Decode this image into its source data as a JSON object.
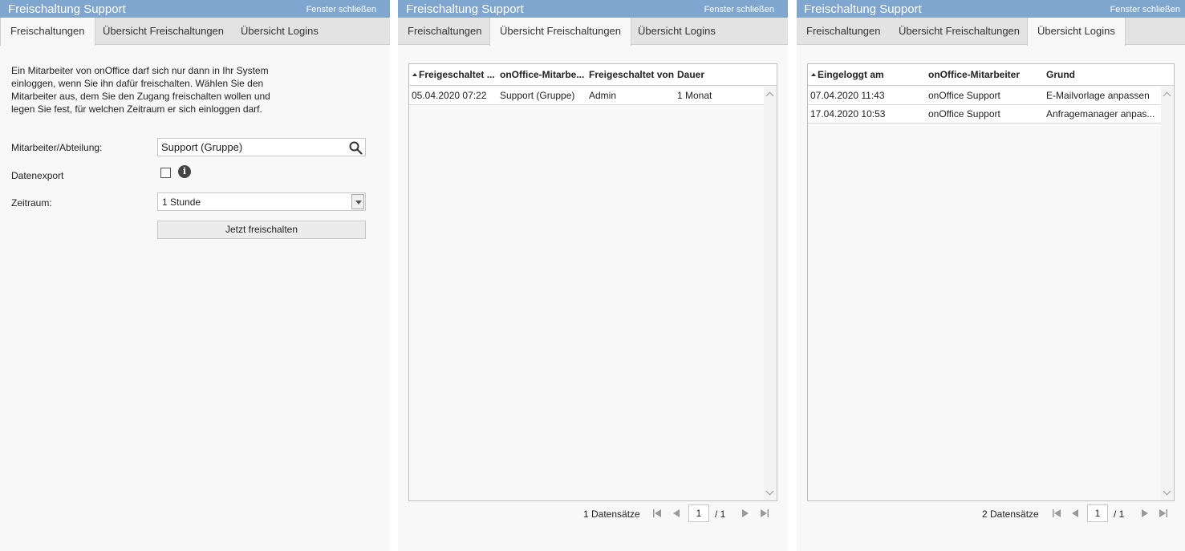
{
  "colors": {
    "titlebar": "#7fa6cf",
    "panel_bg": "#f8f8f8",
    "tabbar_bg": "#e3e3e3"
  },
  "window_title": "Freischaltung Support",
  "close_label": "Fenster schließen",
  "tabs": [
    "Freischaltungen",
    "Übersicht Freischaltungen",
    "Übersicht Logins"
  ],
  "panel1": {
    "intro": "Ein Mitarbeiter von onOffice darf sich nur dann in Ihr System einloggen, wenn Sie ihn dafür freischalten. Wählen Sie den Mitarbeiter aus, dem Sie den Zugang freischalten wollen und legen Sie fest, für welchen Zeitraum er sich einloggen darf.",
    "employee_label": "Mitarbeiter/Abteilung:",
    "employee_value": "Support (Gruppe)",
    "export_label": "Datenexport",
    "export_checked": false,
    "period_label": "Zeitraum:",
    "period_value": "1 Stunde",
    "submit_label": "Jetzt freischalten",
    "search_icon": "search-icon",
    "info_icon": "info-icon"
  },
  "panel2": {
    "columns": [
      "Freigeschaltet ...",
      "onOffice-Mitarbe...",
      "Freigeschaltet von",
      "Dauer"
    ],
    "sorted_column": 0,
    "rows": [
      [
        "05.04.2020 07:22",
        "Support (Gruppe)",
        "Admin",
        "1 Monat"
      ]
    ],
    "count_label": "1 Datensätze",
    "page": "1",
    "pages": "/ 1"
  },
  "panel3": {
    "columns": [
      "Eingeloggt am",
      "onOffice-Mitarbeiter",
      "Grund"
    ],
    "sorted_column": 0,
    "rows": [
      [
        "07.04.2020 11:43",
        "onOffice Support",
        "E-Mailvorlage anpassen"
      ],
      [
        "17.04.2020 10:53",
        "onOffice Support",
        "Anfragemanager anpas..."
      ]
    ],
    "count_label": "2 Datensätze",
    "page": "1",
    "pages": "/ 1"
  }
}
